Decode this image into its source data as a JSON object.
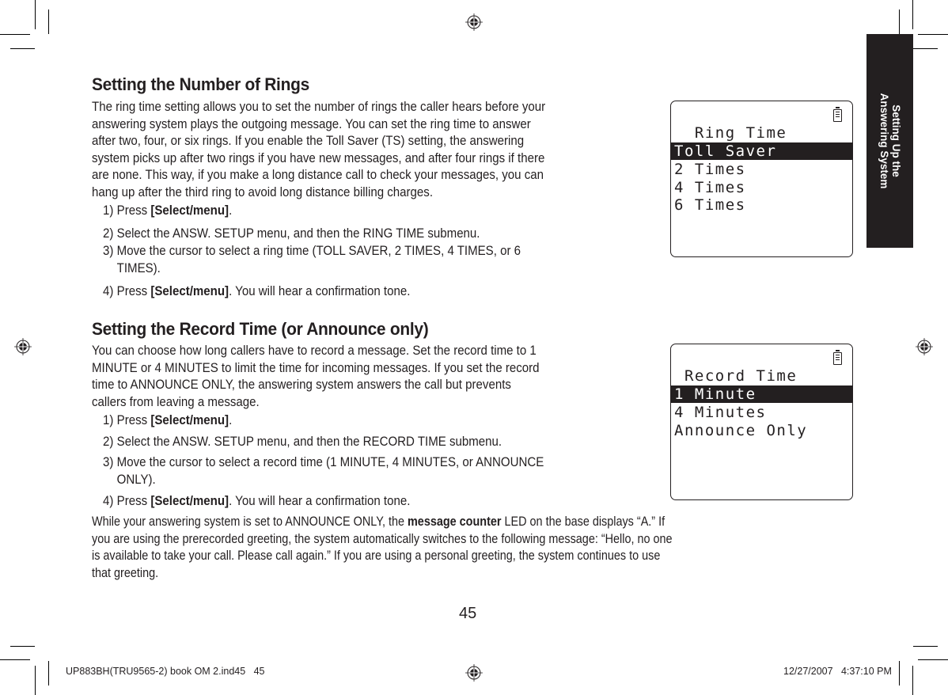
{
  "side_tab": {
    "line1": "Setting Up the",
    "line2": "Answering System"
  },
  "sections": [
    {
      "heading": "Setting the Number of Rings",
      "intro_lines": [
        "The ring time setting allows you to set the number of rings the caller hears before your",
        "answering system plays the outgoing message. You can set the ring time to answer",
        "after two, four, or six rings. If you enable the Toll Saver (TS) setting, the answering",
        "system picks up after two rings if you have new messages, and after four rings if there",
        "are none. This way, if you make a long distance call to check your messages, you can",
        "hang up after the third ring to avoid long distance billing charges."
      ],
      "steps": [
        {
          "num": "1)",
          "pre": "Press ",
          "bold": "[Select/menu]",
          "post": ".",
          "cont": ""
        },
        {
          "num": "2)",
          "pre": "Select the ANSW. SETUP menu, and then the RING TIME submenu.",
          "bold": "",
          "post": "",
          "cont": ""
        },
        {
          "num": "3)",
          "pre": "Move the cursor to select a ring time (TOLL SAVER, 2 TIMES, 4 TIMES, or 6",
          "bold": "",
          "post": "",
          "cont": "TIMES)."
        },
        {
          "num": "4)",
          "pre": "Press ",
          "bold": "[Select/menu]",
          "post": ". You will hear a confirmation tone.",
          "cont": ""
        }
      ],
      "screen": {
        "battery_icon": "battery-icon",
        "title": "  Ring Time",
        "items": [
          "Toll Saver",
          "2 Times",
          "4 Times",
          "6 Times"
        ],
        "selected_index": 0
      }
    },
    {
      "heading": "Setting the Record Time (or Announce only)",
      "intro_lines": [
        "You can choose how long callers have to record a message. Set the record time to 1",
        "MINUTE or 4 MINUTES to limit the time for incoming messages. If you set the record",
        "time to ANNOUNCE ONLY, the answering system answers the call but prevents",
        "callers from leaving a message."
      ],
      "steps": [
        {
          "num": "1)",
          "pre": "Press ",
          "bold": "[Select/menu]",
          "post": ".",
          "cont": ""
        },
        {
          "num": "2)",
          "pre": "Select the ANSW. SETUP menu, and then the RECORD TIME submenu.",
          "bold": "",
          "post": "",
          "cont": ""
        },
        {
          "num": "3)",
          "pre": "Move the cursor to select a record time (1 MINUTE, 4 MINUTES, or ANNOUNCE",
          "bold": "",
          "post": "",
          "cont": "ONLY)."
        },
        {
          "num": "4)",
          "pre": "Press ",
          "bold": "[Select/menu]",
          "post": ". You will hear a confirmation tone.",
          "cont": ""
        }
      ],
      "screen": {
        "battery_icon": "battery-icon",
        "title": " Record Time",
        "items": [
          "1 Minute",
          "4 Minutes",
          "Announce Only"
        ],
        "selected_index": 0
      }
    }
  ],
  "closing": {
    "line1_pre": "While your answering system is set to ANNOUNCE ONLY, the ",
    "line1_bold": "message counter",
    "line1_post": " LED on the base displays “A.” If",
    "line2": "you are using the prerecorded greeting, the system automatically switches to the following message: “Hello, no one",
    "line3": "is available to take your call. Please call again.” If you are using a personal greeting, the system continues to use",
    "line4": "that greeting."
  },
  "page_number": "45",
  "slug": {
    "file": "UP883BH(TRU9565-2) book OM 2.ind45   45",
    "datetime": "12/27/2007   4:37:10 PM"
  }
}
